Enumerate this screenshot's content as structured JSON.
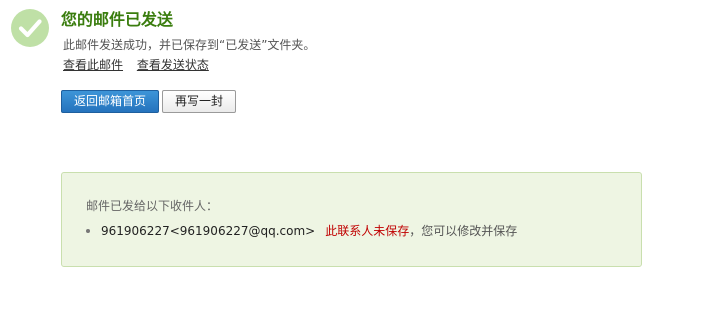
{
  "header": {
    "title": "您的邮件已发送",
    "subtitle": "此邮件发送成功，并已保存到“已发送”文件夹。"
  },
  "links": {
    "view_mail": "查看此邮件",
    "view_status": "查看发送状态"
  },
  "buttons": {
    "back_label": "返回邮箱首页",
    "rewrite_label": "再写一封"
  },
  "panel": {
    "title": "邮件已发给以下收件人：",
    "recipients": [
      {
        "address": "961906227<961906227@qq.com>",
        "status": "此联系人未保存",
        "hint": "，您可以修改并保存"
      }
    ]
  },
  "icons": {
    "success": "check-circle-icon"
  },
  "colors": {
    "title": "#3a7d0e",
    "primary_button": "#2a7fc9",
    "warning_text": "#c00000",
    "panel_bg": "#eef5e3"
  }
}
